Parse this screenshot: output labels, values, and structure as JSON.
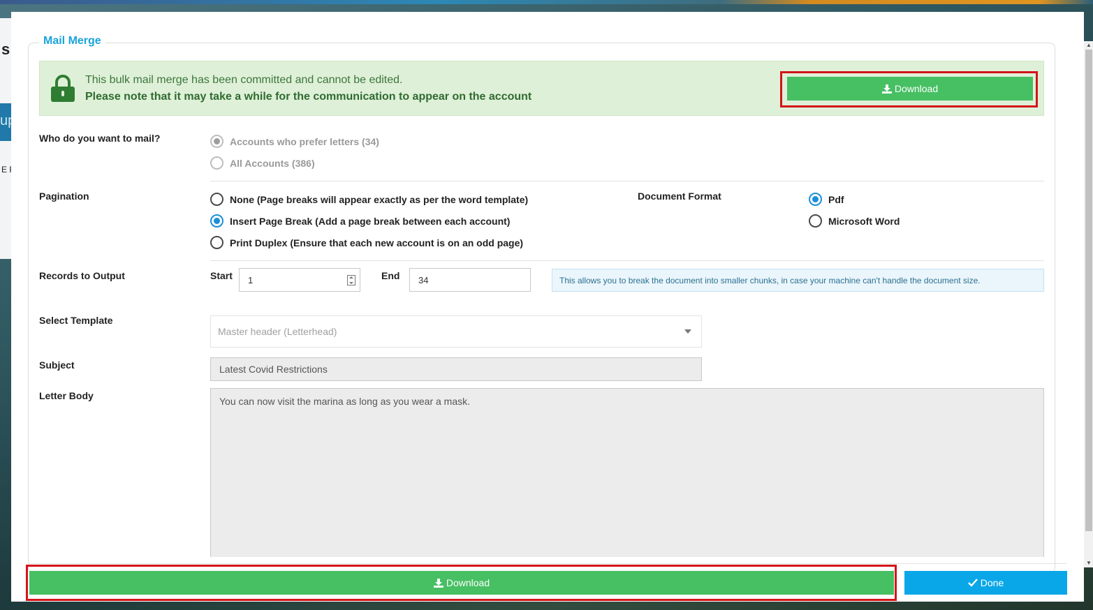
{
  "background": {
    "left_text_top": "s",
    "left_text_mid": "up",
    "left_text_low": "E R"
  },
  "modal": {
    "section_title": "Mail Merge",
    "alert": {
      "line1": "This bulk mail merge has been committed and cannot be edited.",
      "line2": "Please note that it may take a while for the communication to appear on the account",
      "download_label": "Download",
      "icon": "lock-icon"
    },
    "who": {
      "label": "Who do you want to mail?",
      "options": [
        {
          "label": "Accounts who prefer letters (34)",
          "selected": true,
          "disabled": true
        },
        {
          "label": "All Accounts (386)",
          "selected": false,
          "disabled": true
        }
      ]
    },
    "pagination": {
      "label": "Pagination",
      "options": [
        {
          "label": "None (Page breaks will appear exactly as per the word template)",
          "selected": false
        },
        {
          "label": "Insert Page Break (Add a page break between each account)",
          "selected": true
        },
        {
          "label": "Print Duplex (Ensure that each new account is on an odd page)",
          "selected": false
        }
      ]
    },
    "document_format": {
      "label": "Document Format",
      "options": [
        {
          "label": "Pdf",
          "selected": true
        },
        {
          "label": "Microsoft Word",
          "selected": false
        }
      ]
    },
    "records": {
      "label": "Records to Output",
      "start_label": "Start",
      "start_value": "1",
      "end_label": "End",
      "end_value": "34",
      "info": "This allows you to break the document into smaller chunks, in case your machine can't handle the document size."
    },
    "template": {
      "label": "Select Template",
      "placeholder": "Master header (Letterhead)"
    },
    "subject": {
      "label": "Subject",
      "value": "Latest Covid Restrictions"
    },
    "letter_body": {
      "label": "Letter Body",
      "value": "You can now visit the marina as long as you wear a mask."
    }
  },
  "footer": {
    "download_label": "Download",
    "done_label": "Done"
  },
  "colors": {
    "accent_blue": "#0aa7e8",
    "download_green": "#47bf63",
    "alert_bg": "#dff0d8",
    "highlight_red": "#d3141a"
  }
}
